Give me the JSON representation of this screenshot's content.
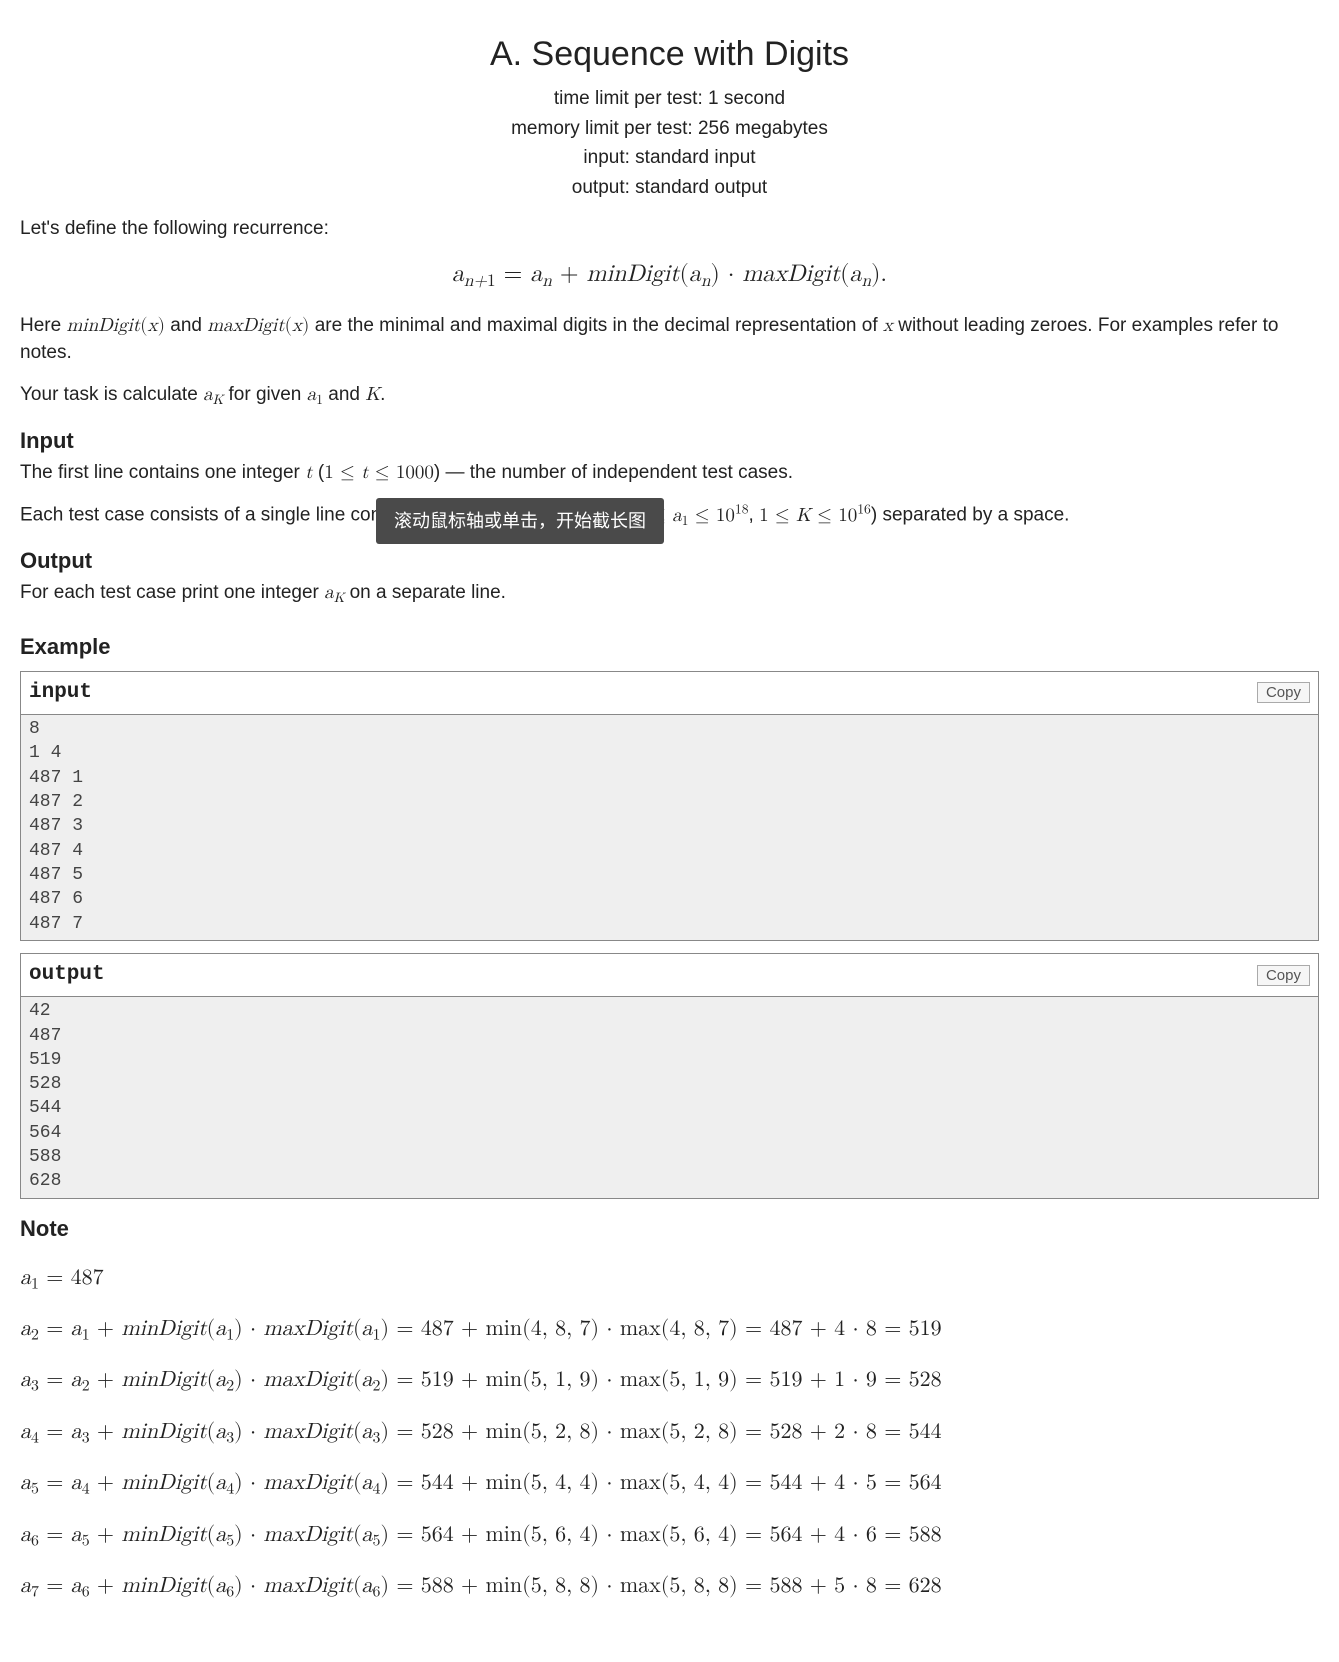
{
  "title": "A. Sequence with Digits",
  "limits": {
    "time": "time limit per test: 1 second",
    "memory": "memory limit per test: 256 megabytes",
    "input": "input: standard input",
    "output": "output: standard output"
  },
  "intro_text": "Let's define the following recurrence:",
  "recurrence_html": "<span class='math'>a<span class='sub'>n+<span class='rm'>1</span></span> <span class='rm'>=</span> a<span class='sub'>n</span> <span class='rm'>+</span> minDigit<span class='rm'>(</span>a<span class='sub'>n</span><span class='rm'>)</span> <span class='rm'>&middot;</span> maxDigit<span class='rm'>(</span>a<span class='sub'>n</span><span class='rm'>).</span></span>",
  "def_html": "Here <span class='math'>minDigit<span class='rm'>(</span>x<span class='rm'>)</span></span> and <span class='math'>maxDigit<span class='rm'>(</span>x<span class='rm'>)</span></span> are the minimal and maximal digits in the decimal representation of <span class='math'>x</span> without leading zeroes. For examples refer to notes.",
  "task_html": "Your task is calculate <span class='math'>a<span class='sub'>K</span></span> for given <span class='math'>a<span class='sub'><span class='rm'>1</span></span></span> and <span class='math'>K</span>.",
  "sections": {
    "input_title": "Input",
    "input_l1_html": "The first line contains one integer <span class='math'>t</span> (<span class='math'><span class='rm'>1 &le;</span> t <span class='rm'>&le; 1000</span></span>) — the number of independent test cases.",
    "input_l2_html": "Each test case consists of a single line containing two integers <span class='math'>a<span class='sub'><span class='rm'>1</span></span></span> and <span class='math'>K</span> (<span class='math'><span class='rm'>1 &le;</span> a<span class='sub'><span class='rm'>1</span></span> <span class='rm'>&le; 10</span><span class='sup'>18</span></span>, <span class='math'><span class='rm'>1 &le;</span> K <span class='rm'>&le; 10</span><span class='sup'>16</span></span>) separated by a space.",
    "output_title": "Output",
    "output_l1_html": "For each test case print one integer <span class='math'>a<span class='sub'>K</span></span> on a separate line.",
    "example_title": "Example",
    "note_title": "Note"
  },
  "io": {
    "input_label": "input",
    "output_label": "output",
    "copy_label": "Copy",
    "input_data": "8\n1 4\n487 1\n487 2\n487 3\n487 4\n487 5\n487 6\n487 7",
    "output_data": "42\n487\n519\n528\n544\n564\n588\n628"
  },
  "notes": [
    "<span class='math'>a<span class='sub'><span class='rm'>1</span></span> <span class='rm'>= 487</span></span>",
    "<span class='math'>a<span class='sub'><span class='rm'>2</span></span> <span class='rm'>=</span> a<span class='sub'><span class='rm'>1</span></span> <span class='rm'>+</span> minDigit<span class='rm'>(</span>a<span class='sub'><span class='rm'>1</span></span><span class='rm'>) &middot;</span> maxDigit<span class='rm'>(</span>a<span class='sub'><span class='rm'>1</span></span><span class='rm'>) = 487 + min(4, 8, 7) &middot; max(4, 8, 7) = 487 + 4 &middot; 8 = 519</span></span>",
    "<span class='math'>a<span class='sub'><span class='rm'>3</span></span> <span class='rm'>=</span> a<span class='sub'><span class='rm'>2</span></span> <span class='rm'>+</span> minDigit<span class='rm'>(</span>a<span class='sub'><span class='rm'>2</span></span><span class='rm'>) &middot;</span> maxDigit<span class='rm'>(</span>a<span class='sub'><span class='rm'>2</span></span><span class='rm'>) = 519 + min(5, 1, 9) &middot; max(5, 1, 9) = 519 + 1 &middot; 9 = 528</span></span>",
    "<span class='math'>a<span class='sub'><span class='rm'>4</span></span> <span class='rm'>=</span> a<span class='sub'><span class='rm'>3</span></span> <span class='rm'>+</span> minDigit<span class='rm'>(</span>a<span class='sub'><span class='rm'>3</span></span><span class='rm'>) &middot;</span> maxDigit<span class='rm'>(</span>a<span class='sub'><span class='rm'>3</span></span><span class='rm'>) = 528 + min(5, 2, 8) &middot; max(5, 2, 8) = 528 + 2 &middot; 8 = 544</span></span>",
    "<span class='math'>a<span class='sub'><span class='rm'>5</span></span> <span class='rm'>=</span> a<span class='sub'><span class='rm'>4</span></span> <span class='rm'>+</span> minDigit<span class='rm'>(</span>a<span class='sub'><span class='rm'>4</span></span><span class='rm'>) &middot;</span> maxDigit<span class='rm'>(</span>a<span class='sub'><span class='rm'>4</span></span><span class='rm'>) = 544 + min(5, 4, 4) &middot; max(5, 4, 4) = 544 + 4 &middot; 5 = 564</span></span>",
    "<span class='math'>a<span class='sub'><span class='rm'>6</span></span> <span class='rm'>=</span> a<span class='sub'><span class='rm'>5</span></span> <span class='rm'>+</span> minDigit<span class='rm'>(</span>a<span class='sub'><span class='rm'>5</span></span><span class='rm'>) &middot;</span> maxDigit<span class='rm'>(</span>a<span class='sub'><span class='rm'>5</span></span><span class='rm'>) = 564 + min(5, 6, 4) &middot; max(5, 6, 4) = 564 + 4 &middot; 6 = 588</span></span>",
    "<span class='math'>a<span class='sub'><span class='rm'>7</span></span> <span class='rm'>=</span> a<span class='sub'><span class='rm'>6</span></span> <span class='rm'>+</span> minDigit<span class='rm'>(</span>a<span class='sub'><span class='rm'>6</span></span><span class='rm'>) &middot;</span> maxDigit<span class='rm'>(</span>a<span class='sub'><span class='rm'>6</span></span><span class='rm'>) = 588 + min(5, 8, 8) &middot; max(5, 8, 8) = 588 + 5 &middot; 8 = 628</span></span>"
  ],
  "tooltip": "滚动鼠标轴或单击，开始截长图"
}
